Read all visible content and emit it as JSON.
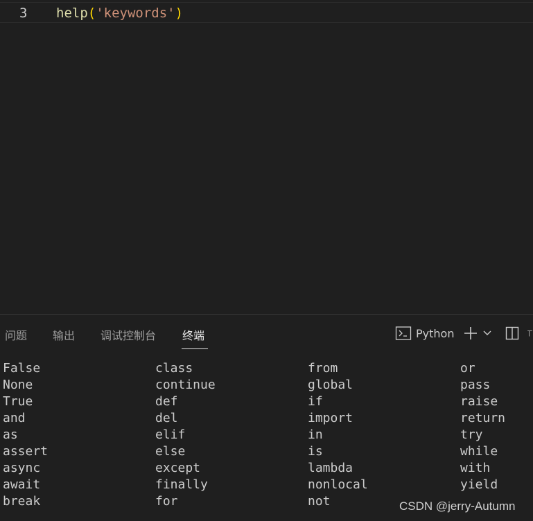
{
  "editor": {
    "line_number": "3",
    "code": {
      "fn": "help",
      "open_paren": "(",
      "string": "'keywords'",
      "close_paren": ")"
    }
  },
  "panel": {
    "tabs": [
      {
        "label": "问题"
      },
      {
        "label": "输出"
      },
      {
        "label": "调试控制台"
      },
      {
        "label": "终端"
      }
    ],
    "active_tab": "终端",
    "terminal_profile": "Python",
    "icons": [
      "terminal-icon",
      "plus-icon",
      "chevron-down-icon",
      "split-icon"
    ]
  },
  "terminal": {
    "columns": [
      [
        "False",
        "None",
        "True",
        "and",
        "as",
        "assert",
        "async",
        "await",
        "break"
      ],
      [
        "class",
        "continue",
        "def",
        "del",
        "elif",
        "else",
        "except",
        "finally",
        "for"
      ],
      [
        "from",
        "global",
        "if",
        "import",
        "in",
        "is",
        "lambda",
        "nonlocal",
        "not"
      ],
      [
        "or",
        "pass",
        "raise",
        "return",
        "try",
        "while",
        "with",
        "yield"
      ]
    ]
  },
  "watermark": "CSDN @jerry-Autumn",
  "colors": {
    "background": "#1e1e1e",
    "function": "#dcdcaa",
    "bracket": "#ffd700",
    "string": "#ce9178",
    "text": "#cccccc"
  }
}
